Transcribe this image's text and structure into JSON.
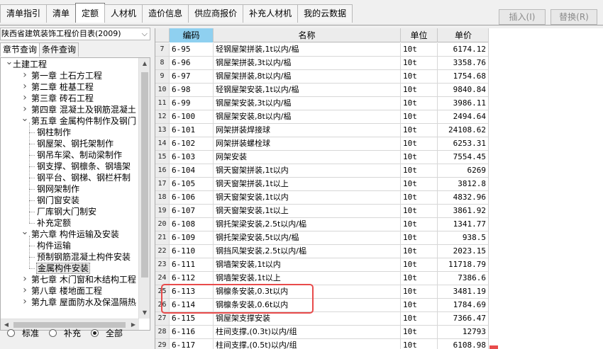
{
  "top_tabs": [
    "清单指引",
    "清单",
    "定额",
    "人材机",
    "造价信息",
    "供应商报价",
    "补充人材机",
    "我的云数据"
  ],
  "active_tab": "定额",
  "buttons": {
    "insert": "插入(I)",
    "replace": "替换(R)"
  },
  "library_select": "陕西省建筑装饰工程价目表(2009)",
  "sub_tabs": [
    "章节查询",
    "条件查询"
  ],
  "active_sub_tab": "章节查询",
  "tree": [
    {
      "label": "土建工程",
      "level": 0,
      "toggle": "v"
    },
    {
      "label": "第一章 土石方工程",
      "level": 1,
      "toggle": ">"
    },
    {
      "label": "第二章 桩基工程",
      "level": 1,
      "toggle": ">"
    },
    {
      "label": "第三章 砖石工程",
      "level": 1,
      "toggle": ">"
    },
    {
      "label": "第四章 混凝土及钢筋混凝土",
      "level": 1,
      "toggle": ">"
    },
    {
      "label": "第五章 金属构件制作及钢门",
      "level": 1,
      "toggle": "v"
    },
    {
      "label": "钢柱制作",
      "level": 2
    },
    {
      "label": "钢屋架、钢托架制作",
      "level": 2
    },
    {
      "label": "钢吊车梁、制动梁制作",
      "level": 2
    },
    {
      "label": "钢支撑、钢檩条、钢墙架",
      "level": 2
    },
    {
      "label": "钢平台、钢梯、钢栏杆制",
      "level": 2
    },
    {
      "label": "钢网架制作",
      "level": 2
    },
    {
      "label": "钢门窗安装",
      "level": 2
    },
    {
      "label": "厂库钢大门制安",
      "level": 2
    },
    {
      "label": "补充定额",
      "level": 2
    },
    {
      "label": "第六章 构件运输及安装",
      "level": 1,
      "toggle": "v"
    },
    {
      "label": "构件运输",
      "level": 2
    },
    {
      "label": "预制钢筋混凝土构件安装",
      "level": 2
    },
    {
      "label": "金属构件安装",
      "level": 2,
      "selected": true
    },
    {
      "label": "第七章 木门窗和木结构工程",
      "level": 1,
      "toggle": ">"
    },
    {
      "label": "第八章 楼地面工程",
      "level": 1,
      "toggle": ">"
    },
    {
      "label": "第九章 屋面防水及保温隔热",
      "level": 1,
      "toggle": ">"
    }
  ],
  "radio_options": [
    "标准",
    "补充",
    "全部"
  ],
  "radio_selected": "全部",
  "grid_headers": [
    "",
    "编码",
    "名称",
    "单位",
    "单价"
  ],
  "rows": [
    {
      "idx": "7",
      "code": "6-95",
      "name": "轻钢屋架拼装,1t以内/榀",
      "unit": "10t",
      "price": "6174.12"
    },
    {
      "idx": "8",
      "code": "6-96",
      "name": "钢屋架拼装,3t以内/榀",
      "unit": "10t",
      "price": "3358.76"
    },
    {
      "idx": "9",
      "code": "6-97",
      "name": "钢屋架拼装,8t以内/榀",
      "unit": "10t",
      "price": "1754.68"
    },
    {
      "idx": "10",
      "code": "6-98",
      "name": "轻钢屋架安装,1t以内/榀",
      "unit": "10t",
      "price": "9840.84"
    },
    {
      "idx": "11",
      "code": "6-99",
      "name": "钢屋架安装,3t以内/榀",
      "unit": "10t",
      "price": "3986.11"
    },
    {
      "idx": "12",
      "code": "6-100",
      "name": "钢屋架安装,8t以内/榀",
      "unit": "10t",
      "price": "2494.64"
    },
    {
      "idx": "13",
      "code": "6-101",
      "name": "网架拼装焊接球",
      "unit": "10t",
      "price": "24108.62"
    },
    {
      "idx": "14",
      "code": "6-102",
      "name": "网架拼装螺栓球",
      "unit": "10t",
      "price": "6253.31"
    },
    {
      "idx": "15",
      "code": "6-103",
      "name": "网架安装",
      "unit": "10t",
      "price": "7554.45"
    },
    {
      "idx": "16",
      "code": "6-104",
      "name": "钢天窗架拼装,1t以内",
      "unit": "10t",
      "price": "6269"
    },
    {
      "idx": "17",
      "code": "6-105",
      "name": "钢天窗架拼装,1t以上",
      "unit": "10t",
      "price": "3812.8"
    },
    {
      "idx": "18",
      "code": "6-106",
      "name": "钢天窗架安装,1t以内",
      "unit": "10t",
      "price": "4832.96"
    },
    {
      "idx": "19",
      "code": "6-107",
      "name": "钢天窗架安装,1t以上",
      "unit": "10t",
      "price": "3861.92"
    },
    {
      "idx": "20",
      "code": "6-108",
      "name": "钢托架梁安装,2.5t以内/榀",
      "unit": "10t",
      "price": "1341.77"
    },
    {
      "idx": "21",
      "code": "6-109",
      "name": "钢托架梁安装,5t以内/榀",
      "unit": "10t",
      "price": "938.5"
    },
    {
      "idx": "22",
      "code": "6-110",
      "name": "钢挡风架安装,2.5t以内/榀",
      "unit": "10t",
      "price": "2023.15"
    },
    {
      "idx": "23",
      "code": "6-111",
      "name": "钢墙架安装,1t以内",
      "unit": "10t",
      "price": "11718.79"
    },
    {
      "idx": "24",
      "code": "6-112",
      "name": "钢墙架安装,1t以上",
      "unit": "10t",
      "price": "7386.6"
    },
    {
      "idx": "25",
      "code": "6-113",
      "name": "钢檩条安装,0.3t以内",
      "unit": "10t",
      "price": "3481.19"
    },
    {
      "idx": "26",
      "code": "6-114",
      "name": "钢檩条安装,0.6t以内",
      "unit": "10t",
      "price": "1784.69"
    },
    {
      "idx": "27",
      "code": "6-115",
      "name": "钢屋架支撑安装",
      "unit": "10t",
      "price": "7366.47"
    },
    {
      "idx": "28",
      "code": "6-116",
      "name": "柱间支撑,(0.3t)以内/组",
      "unit": "10t",
      "price": "12793"
    },
    {
      "idx": "29",
      "code": "6-117",
      "name": "柱间支撑,(0.5t)以内/组",
      "unit": "10t",
      "price": "6108.98"
    }
  ]
}
